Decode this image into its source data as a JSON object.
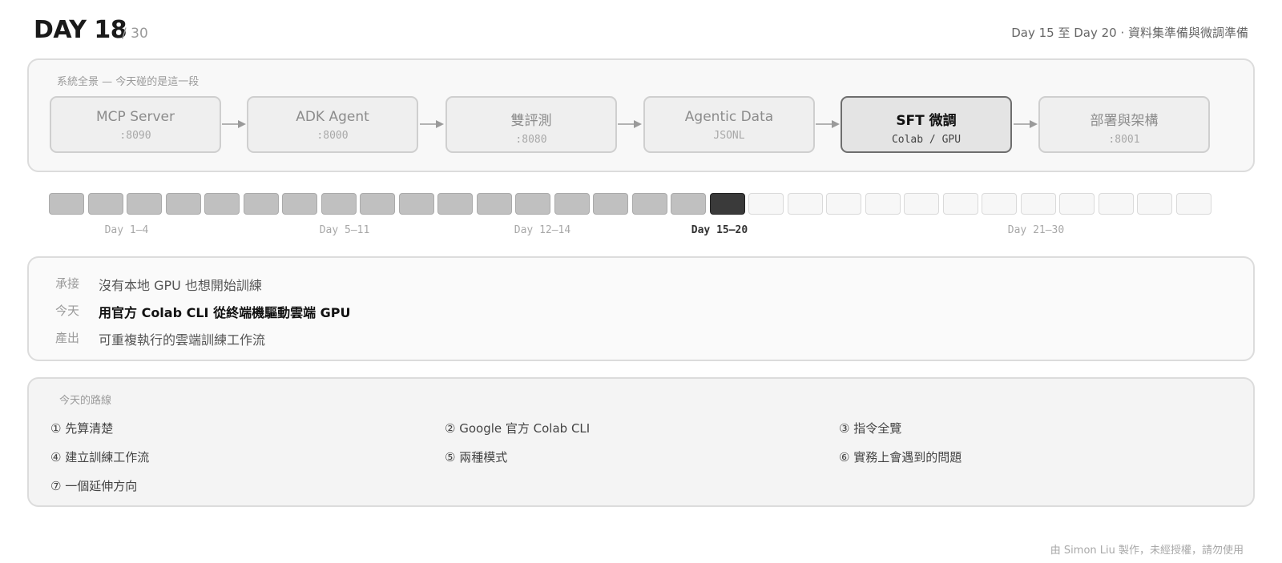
{
  "header": {
    "title": "DAY 18",
    "total": "/ 30",
    "phase": "Day 15 至 Day 20 · 資料集準備與微調準備"
  },
  "pipeline": {
    "caption": "系統全景 — 今天碰的是這一段",
    "stages": [
      {
        "name": "MCP Server",
        "sub": ":8090"
      },
      {
        "name": "ADK Agent",
        "sub": ":8000"
      },
      {
        "name": "雙評測",
        "sub": ":8080"
      },
      {
        "name": "Agentic Data",
        "sub": "JSONL"
      },
      {
        "name": "SFT 微調",
        "sub": "Colab / GPU"
      },
      {
        "name": "部署與架構",
        "sub": ":8001"
      }
    ],
    "active_index": 4
  },
  "progress": {
    "total_days": 30,
    "current_day": 18,
    "ranges": [
      "Day 1–4",
      "Day 5–11",
      "Day 12–14",
      "Day 15–20",
      "Day 21–30"
    ],
    "active_range_index": 3
  },
  "summary": {
    "inherit_label": "承接",
    "inherit": "沒有本地 GPU 也想開始訓練",
    "today_label": "今天",
    "today": "用官方 Colab CLI 從終端機驅動雲端 GPU",
    "output_label": "產出",
    "output": "可重複執行的雲端訓練工作流"
  },
  "route": {
    "caption": "今天的路線",
    "items": [
      "① 先算清楚",
      "② Google 官方 Colab CLI",
      "③ 指令全覽",
      "④ 建立訓練工作流",
      "⑤ 兩種模式",
      "⑥ 實務上會遇到的問題",
      "⑦ 一個延伸方向"
    ]
  },
  "footer": "由 Simon Liu 製作，未經授權，請勿使用",
  "colors": {
    "done": "#c0c0c0",
    "current": "#3a3a3a",
    "future": "#f7f7f7",
    "active_border": "#6e6e6e"
  }
}
